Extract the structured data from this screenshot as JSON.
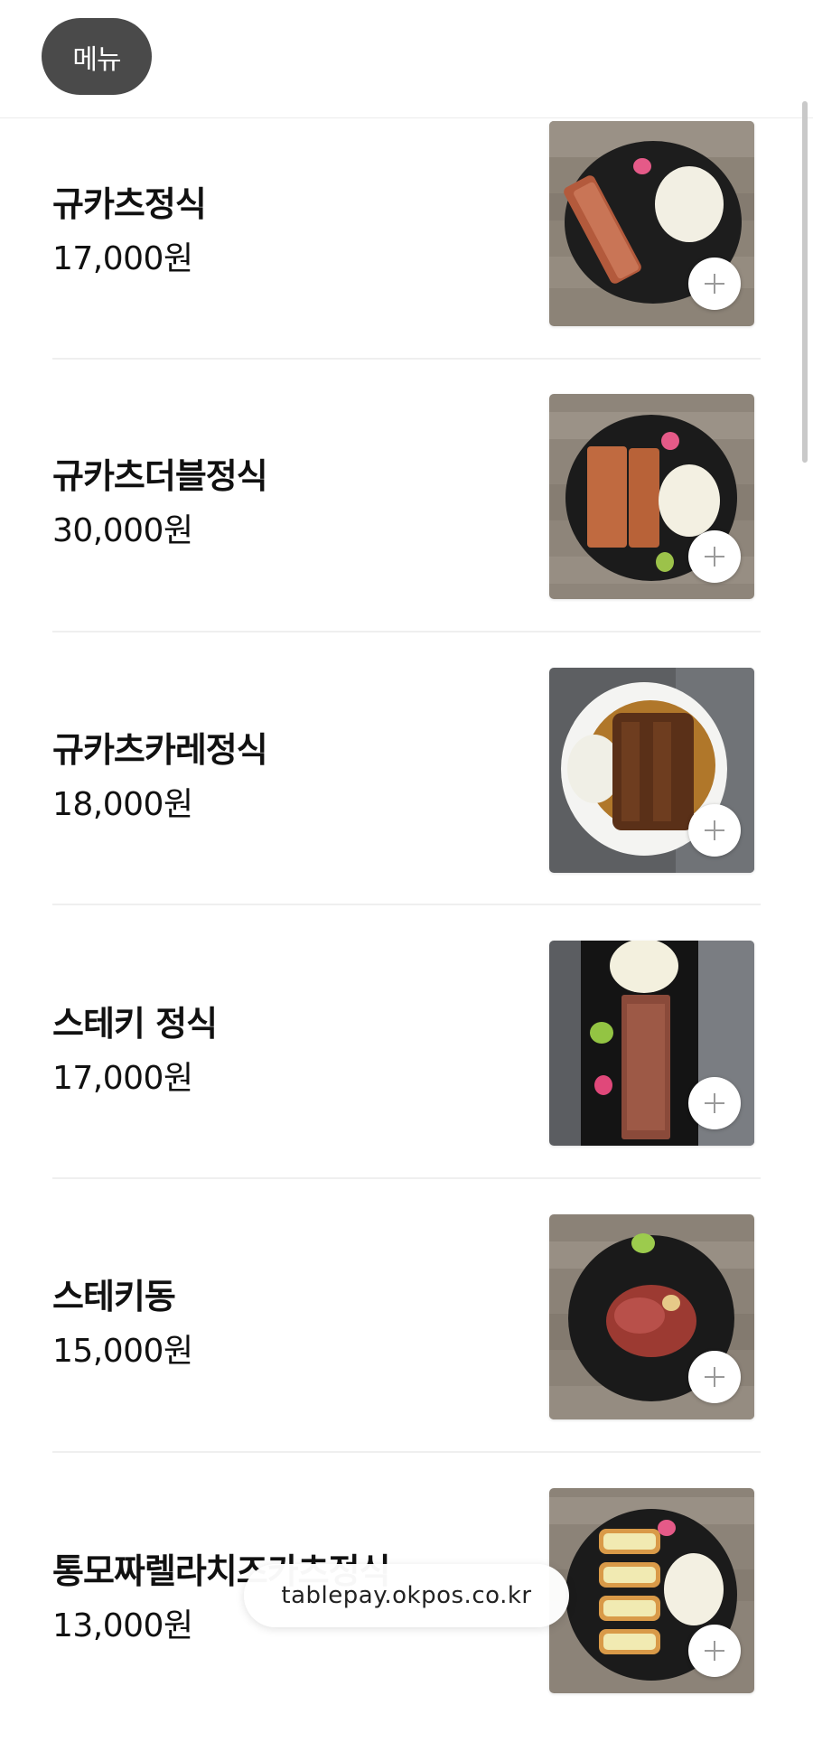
{
  "header": {
    "menu_button_label": "메뉴"
  },
  "menu_items": [
    {
      "name": "규카츠정식",
      "price": "17,000원",
      "image": "gyukatsu-set-photo",
      "add_icon": "plus-icon"
    },
    {
      "name": "규카츠더블정식",
      "price": "30,000원",
      "image": "gyukatsu-double-set-photo",
      "add_icon": "plus-icon"
    },
    {
      "name": "규카츠카레정식",
      "price": "18,000원",
      "image": "gyukatsu-curry-set-photo",
      "add_icon": "plus-icon"
    },
    {
      "name": "스테키 정식",
      "price": "17,000원",
      "image": "steak-set-photo",
      "add_icon": "plus-icon"
    },
    {
      "name": "스테키동",
      "price": "15,000원",
      "image": "steak-don-photo",
      "add_icon": "plus-icon"
    },
    {
      "name": "통모짜렐라치즈카츠정식",
      "price": "13,000원",
      "image": "mozzarella-cheese-katsu-set-photo",
      "add_icon": "plus-icon"
    }
  ],
  "browser": {
    "url": "tablepay.okpos.co.kr"
  },
  "colors": {
    "menu_pill_bg": "#4a4a4a",
    "divider": "#efefef",
    "plus_icon": "#9a9a9a"
  }
}
